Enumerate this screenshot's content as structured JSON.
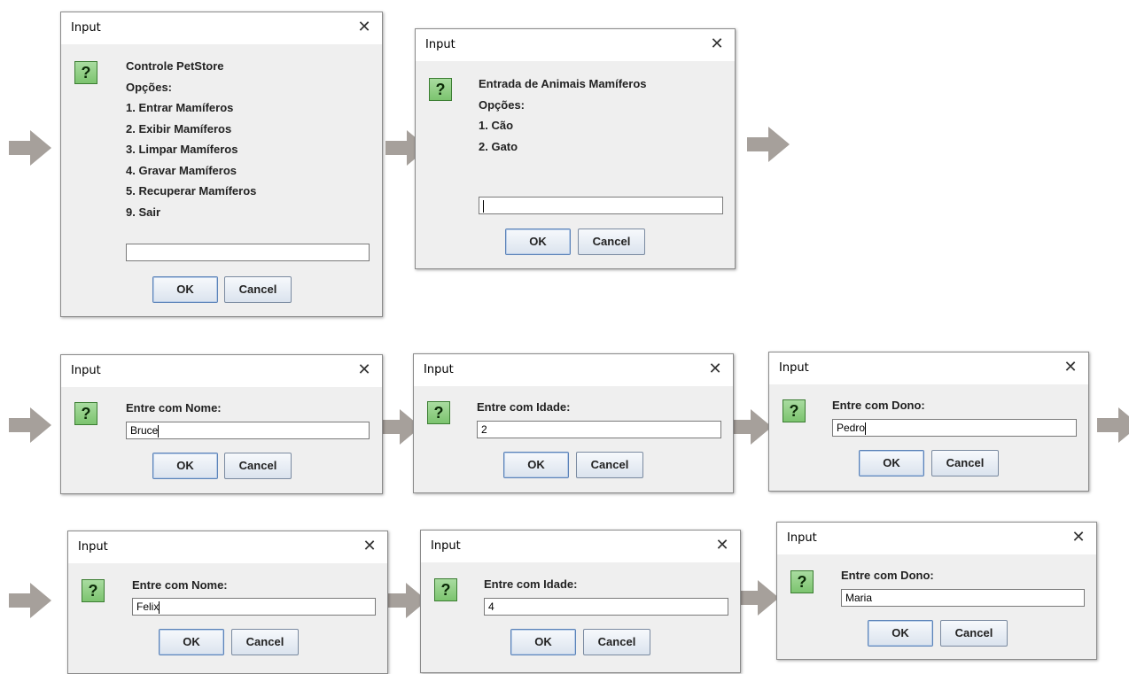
{
  "window_title": "Input",
  "ok_label": "OK",
  "cancel_label": "Cancel",
  "question_icon": "question-icon",
  "colors": {
    "arrow": "#a6a09b",
    "icon_green": "#86c97a",
    "dialog_bg": "#efefef"
  },
  "dialogs": [
    {
      "title": "Input",
      "message_lines": [
        "Controle PetStore",
        "Opções:",
        "1. Entrar Mamíferos",
        "2. Exibir Mamíferos",
        "3. Limpar Mamíferos",
        "4. Gravar Mamíferos",
        "5. Recuperar Mamíferos",
        "9. Sair"
      ],
      "input_value": ""
    },
    {
      "title": "Input",
      "message_lines": [
        "Entrada de Animais Mamíferos",
        "Opções:",
        "1. Cão",
        "2. Gato"
      ],
      "input_value": ""
    },
    {
      "title": "Input",
      "message_lines": [
        "Entre com Nome:"
      ],
      "input_value": "Bruce"
    },
    {
      "title": "Input",
      "message_lines": [
        "Entre com Idade:"
      ],
      "input_value": "2"
    },
    {
      "title": "Input",
      "message_lines": [
        "Entre com Dono:"
      ],
      "input_value": "Pedro"
    },
    {
      "title": "Input",
      "message_lines": [
        "Entre com Nome:"
      ],
      "input_value": "Felix"
    },
    {
      "title": "Input",
      "message_lines": [
        "Entre com Idade:"
      ],
      "input_value": "4"
    },
    {
      "title": "Input",
      "message_lines": [
        "Entre com Dono:"
      ],
      "input_value": "Maria"
    }
  ]
}
